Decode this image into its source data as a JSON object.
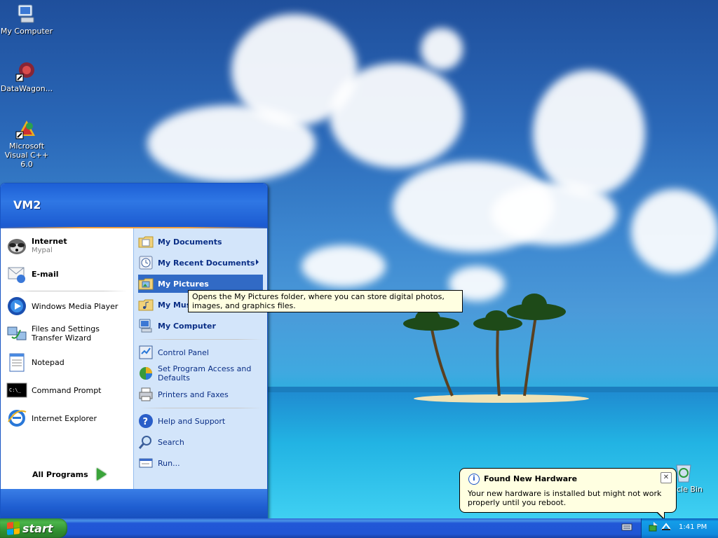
{
  "desktop": {
    "icons": [
      {
        "label": "My Computer",
        "icon": "my-computer-icon"
      },
      {
        "label": "DataWagon...",
        "icon": "datawagon-icon"
      },
      {
        "label": "Microsoft Visual C++ 6.0",
        "icon": "visual-cpp-icon"
      },
      {
        "label": "ycle Bin",
        "icon": "recycle-bin-icon"
      }
    ]
  },
  "start_menu": {
    "user_name": "VM2",
    "left": {
      "pinned": [
        {
          "label": "Internet",
          "sub": "Mypal",
          "icon": "raccoon-browser-icon"
        },
        {
          "label": "E-mail",
          "icon": "email-icon"
        }
      ],
      "recent": [
        {
          "label": "Windows Media Player",
          "icon": "media-player-icon"
        },
        {
          "label": "Files and Settings Transfer Wizard",
          "icon": "transfer-wizard-icon"
        },
        {
          "label": "Notepad",
          "icon": "notepad-icon"
        },
        {
          "label": "Command Prompt",
          "icon": "command-prompt-icon"
        },
        {
          "label": "Internet Explorer",
          "icon": "internet-explorer-icon"
        }
      ],
      "all_programs": "All Programs"
    },
    "right": {
      "items": [
        {
          "label": "My Documents",
          "icon": "folder-documents-icon",
          "bold": true
        },
        {
          "label": "My Recent Documents",
          "icon": "recent-documents-icon",
          "bold": true,
          "submenu": true
        },
        {
          "label": "My Pictures",
          "icon": "folder-pictures-icon",
          "bold": true,
          "selected": true
        },
        {
          "label": "My Music",
          "icon": "folder-music-icon",
          "bold": true
        },
        {
          "label": "My Computer",
          "icon": "my-computer-icon",
          "bold": true
        },
        {
          "label": "Control Panel",
          "icon": "control-panel-icon"
        },
        {
          "label": "Set Program Access and Defaults",
          "icon": "program-defaults-icon"
        },
        {
          "label": "Printers and Faxes",
          "icon": "printer-icon"
        },
        {
          "label": "Help and Support",
          "icon": "help-icon"
        },
        {
          "label": "Search",
          "icon": "search-icon"
        },
        {
          "label": "Run...",
          "icon": "run-icon"
        }
      ]
    },
    "tooltip": "Opens the My Pictures folder, where you can store digital photos, images, and graphics files."
  },
  "balloon": {
    "title": "Found New Hardware",
    "message": "Your new hardware is installed but might not work properly until you reboot."
  },
  "taskbar": {
    "start_label": "start",
    "clock": "1:41 PM",
    "tray_icons": [
      "keyboard-icon",
      "safely-remove-hardware-icon",
      "network-icon"
    ]
  },
  "colors": {
    "taskbar_blue": "#2056d4",
    "start_green": "#3c9a3c",
    "menu_header_blue": "#1d5fd6",
    "menu_right_panel": "#d3e5fa",
    "selection_blue": "#316ac5",
    "tooltip_bg": "#ffffe1"
  }
}
